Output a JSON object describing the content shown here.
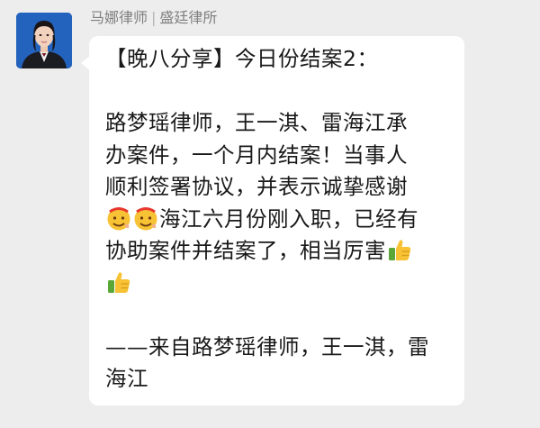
{
  "header": {
    "sender_name": "马娜律师",
    "separator": "|",
    "organization": "盛廷律所"
  },
  "message": {
    "title": "【晚八分享】今日份结案2：",
    "lines": [
      "路梦瑶律师，王一淇、雷海江承",
      "办案件，一个月内结案！当事人",
      "顺利签署协议，并表示诚挚感谢",
      "海江六月份刚入职，已经有",
      "协助案件并结案了，相当厉害",
      "——来自路梦瑶律师，王一淇，雷",
      "海江"
    ],
    "emojis": {
      "praise_face": "666-face-emoji",
      "thumbs_up": "thumbs-up-emoji"
    }
  },
  "colors": {
    "background": "#ededed",
    "bubble": "#ffffff",
    "text": "#191919",
    "sender": "#7f7f7f",
    "emoji_yellow": "#f7c233",
    "emoji_red": "#e8372f",
    "thumb_green": "#5aa637"
  }
}
